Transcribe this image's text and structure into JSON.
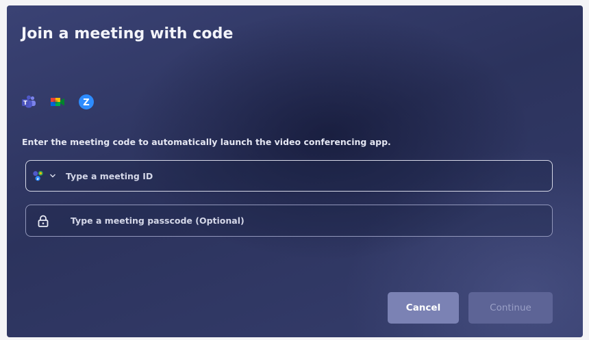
{
  "dialog": {
    "title": "Join a meeting with code",
    "apps": [
      {
        "name": "microsoft-teams-icon"
      },
      {
        "name": "google-meet-icon"
      },
      {
        "name": "zoom-icon"
      }
    ],
    "description": "Enter the meeting code to automatically launch the video conferencing app."
  },
  "meeting_id": {
    "value": "",
    "placeholder": "Type a meeting ID",
    "picker_icon": "multi-app-icon"
  },
  "passcode": {
    "value": "",
    "placeholder": "Type a meeting passcode (Optional)",
    "icon": "lock-icon"
  },
  "actions": {
    "cancel_label": "Cancel",
    "continue_label": "Continue"
  },
  "colors": {
    "dialog_bg": "#2f365f",
    "cancel_bg": "#7b82b4",
    "continue_disabled_bg": "#5d6496",
    "teams": "#5059c9",
    "zoom": "#2d8cff"
  }
}
